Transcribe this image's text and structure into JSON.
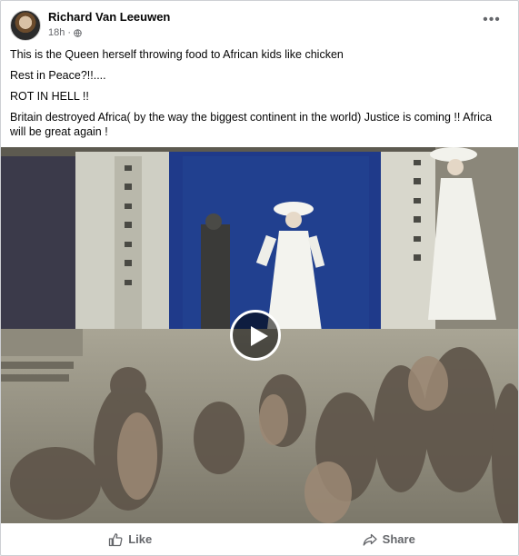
{
  "post": {
    "author": "Richard Van Leeuwen",
    "time": "18h",
    "audience_icon": "globe-icon",
    "more_icon": "more-horizontal-icon",
    "more_label": "•••",
    "paragraphs": [
      "This is the Queen herself throwing food to African kids like chicken",
      "Rest in Peace?!!....",
      "ROT IN HELL !!",
      "Britain destroyed Africa( by the way the biggest continent in the world) Justice is coming !!  Africa will be great again !"
    ]
  },
  "video": {
    "play_icon": "play-icon"
  },
  "actions": {
    "like_label": "Like",
    "like_icon": "thumbs-up-icon",
    "share_label": "Share",
    "share_icon": "share-arrow-icon"
  },
  "colors": {
    "text": "#050505",
    "secondary": "#65676b",
    "divider": "#ced0d4"
  }
}
